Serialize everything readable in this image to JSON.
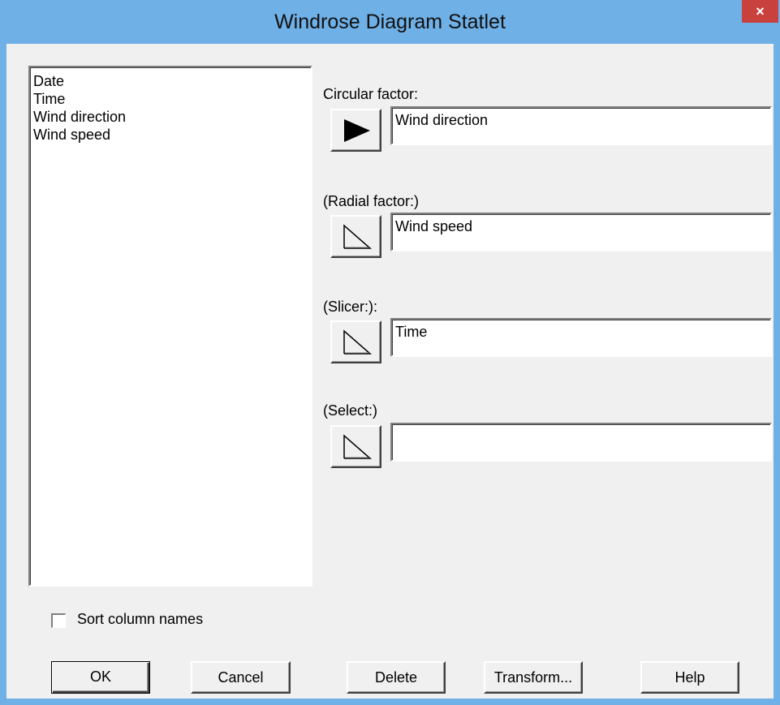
{
  "window": {
    "title": "Windrose Diagram Statlet",
    "close_glyph": "×"
  },
  "column_list": {
    "items": [
      "Date",
      "Time",
      "Wind direction",
      "Wind speed"
    ]
  },
  "fields": {
    "circular_factor": {
      "label": "Circular factor:",
      "value": "Wind direction",
      "arrow_icon": "filled-arrow-icon"
    },
    "radial_factor": {
      "label": "(Radial factor:)",
      "value": "Wind speed",
      "arrow_icon": "outline-arrow-icon"
    },
    "slicer": {
      "label": "(Slicer:):",
      "value": "Time",
      "arrow_icon": "outline-arrow-icon"
    },
    "select": {
      "label": "(Select:)",
      "value": "",
      "arrow_icon": "outline-arrow-icon"
    }
  },
  "sort_columns": {
    "label": "Sort column names",
    "checked": false
  },
  "buttons": {
    "ok": "OK",
    "cancel": "Cancel",
    "delete": "Delete",
    "transform": "Transform...",
    "help": "Help"
  },
  "colors": {
    "titlebar": "#6fb0e6",
    "close": "#c8413c",
    "dialog_bg": "#f0f0f0"
  }
}
